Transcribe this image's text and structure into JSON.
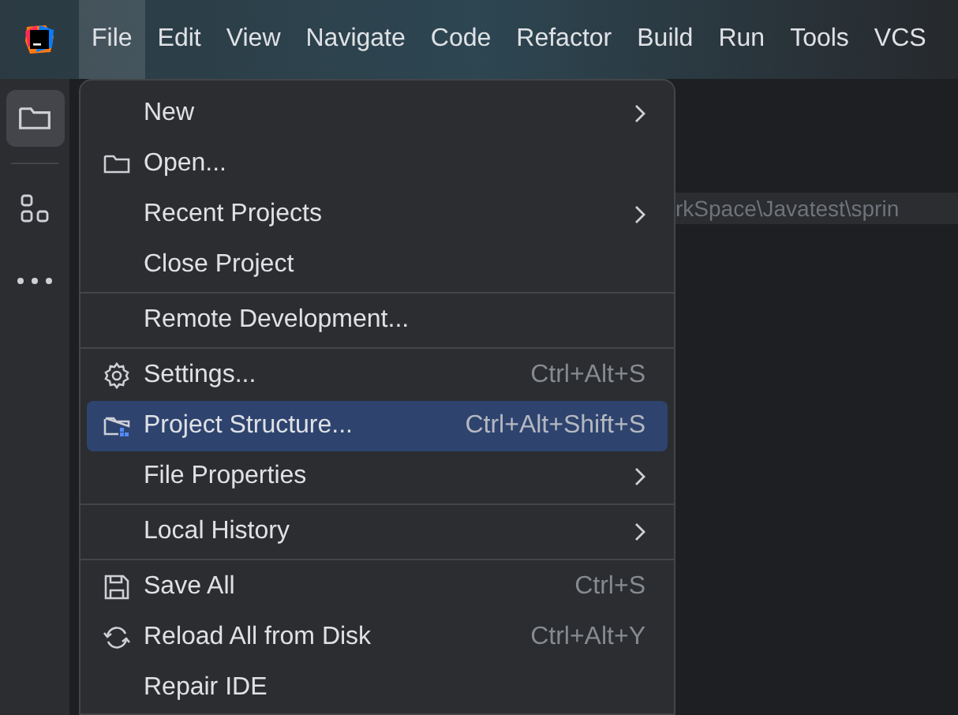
{
  "menu_bar": [
    {
      "label": "File",
      "selected": true
    },
    {
      "label": "Edit",
      "selected": false
    },
    {
      "label": "View",
      "selected": false
    },
    {
      "label": "Navigate",
      "selected": false
    },
    {
      "label": "Code",
      "selected": false
    },
    {
      "label": "Refactor",
      "selected": false
    },
    {
      "label": "Build",
      "selected": false
    },
    {
      "label": "Run",
      "selected": false
    },
    {
      "label": "Tools",
      "selected": false
    },
    {
      "label": "VCS",
      "selected": false
    }
  ],
  "side_toolbar": [
    {
      "kind": "folder",
      "selected": true
    },
    {
      "kind": "structure",
      "selected": false
    },
    {
      "kind": "more",
      "selected": false
    }
  ],
  "path_field": {
    "value": "rkSpace\\Javatest\\sprin"
  },
  "file_menu": [
    {
      "kind": "item",
      "label": "New",
      "submenu": true,
      "selected": false
    },
    {
      "kind": "item",
      "label": "Open...",
      "submenu": false,
      "selected": false
    },
    {
      "kind": "item",
      "label": "Recent Projects",
      "submenu": true,
      "selected": false
    },
    {
      "kind": "item",
      "label": "Close Project",
      "submenu": false,
      "selected": false
    },
    {
      "kind": "separator"
    },
    {
      "kind": "item",
      "label": "Remote Development...",
      "submenu": false,
      "selected": false
    },
    {
      "kind": "separator"
    },
    {
      "kind": "item",
      "label": "Settings...",
      "shortcut": "Ctrl+Alt+S",
      "submenu": false,
      "selected": false
    },
    {
      "kind": "item",
      "label": "Project Structure...",
      "shortcut": "Ctrl+Alt+Shift+S",
      "submenu": false,
      "selected": true
    },
    {
      "kind": "item",
      "label": "File Properties",
      "submenu": true,
      "selected": false
    },
    {
      "kind": "separator"
    },
    {
      "kind": "item",
      "label": "Local History",
      "submenu": true,
      "selected": false
    },
    {
      "kind": "separator"
    },
    {
      "kind": "item",
      "label": "Save All",
      "shortcut": "Ctrl+S",
      "submenu": false,
      "selected": false
    },
    {
      "kind": "item",
      "label": "Reload All from Disk",
      "shortcut": "Ctrl+Alt+Y",
      "submenu": false,
      "selected": false
    },
    {
      "kind": "item",
      "label": "Repair IDE",
      "submenu": false,
      "selected": false
    }
  ]
}
